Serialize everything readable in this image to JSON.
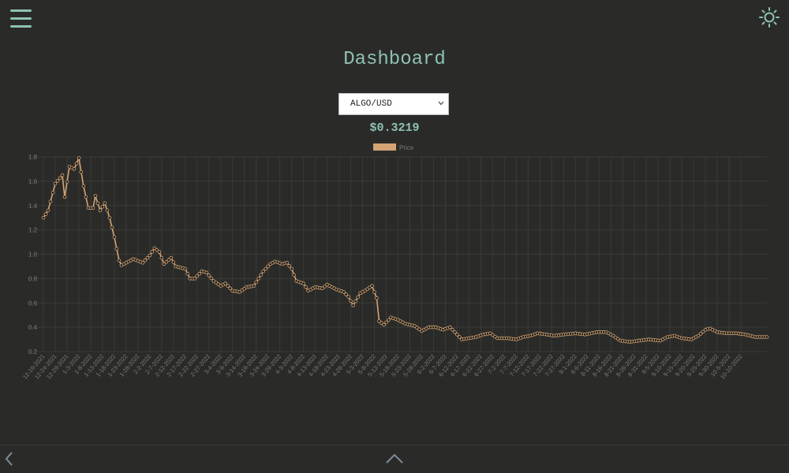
{
  "header": {
    "menu_icon": "hamburger-menu-icon",
    "theme_icon": "sun-icon",
    "title": "Dashboard"
  },
  "selector": {
    "selected": "ALGO/USD",
    "icon": "chevron-down-icon"
  },
  "current_price": "$0.3219",
  "footer": {
    "back_icon": "chevron-left-icon",
    "up_icon": "chevron-up-icon"
  },
  "colors": {
    "background": "#2a2b29",
    "accent": "#8fc1b2",
    "series": "#d4a373",
    "axis_text": "#7a7a7a",
    "grid": "#3a3b38"
  },
  "chart_data": {
    "type": "line",
    "legend": {
      "position": "top",
      "entries": [
        "Price"
      ]
    },
    "ylim": [
      0.2,
      1.8
    ],
    "y_ticks": [
      "0.2",
      "0.4",
      "0.6",
      "0.8",
      "1.0",
      "1.2",
      "1.4",
      "1.6",
      "1.8"
    ],
    "grid": true,
    "x_ticks": [
      "12-19-2021",
      "12-24-2021",
      "12-29-2021",
      "1-3-2022",
      "1-8-2022",
      "1-13-2022",
      "1-18-2022",
      "1-23-2022",
      "1-28-2022",
      "2-2-2022",
      "2-7-2022",
      "2-12-2022",
      "2-17-2022",
      "2-22-2022",
      "2-27-2022",
      "3-4-2022",
      "3-9-2022",
      "3-14-2022",
      "3-19-2022",
      "3-24-2022",
      "3-29-2022",
      "4-3-2022",
      "4-8-2022",
      "4-13-2022",
      "4-18-2022",
      "4-23-2022",
      "4-28-2022",
      "5-3-2022",
      "5-8-2022",
      "5-13-2022",
      "5-18-2022",
      "5-23-2022",
      "5-28-2022",
      "6-2-2022",
      "6-7-2022",
      "6-12-2022",
      "6-17-2022",
      "6-22-2022",
      "6-27-2022",
      "7-2-2022",
      "7-7-2022",
      "7-12-2022",
      "7-17-2022",
      "7-22-2022",
      "7-27-2022",
      "8-1-2022",
      "8-6-2022",
      "8-11-2022",
      "8-16-2022",
      "8-21-2022",
      "8-26-2022",
      "8-31-2022",
      "9-5-2022",
      "9-10-2022",
      "9-15-2022",
      "9-20-2022",
      "9-25-2022",
      "9-30-2022",
      "10-5-2022",
      "10-10-2022"
    ],
    "series": [
      {
        "name": "Price",
        "step_days": 1,
        "start_date": "12-19-2021",
        "keyframes": [
          {
            "date": "12-19-2021",
            "value": 1.3
          },
          {
            "date": "12-21-2021",
            "value": 1.36
          },
          {
            "date": "12-24-2021",
            "value": 1.58
          },
          {
            "date": "12-27-2021",
            "value": 1.65
          },
          {
            "date": "12-28-2021",
            "value": 1.47
          },
          {
            "date": "12-30-2021",
            "value": 1.72
          },
          {
            "date": "1-1-2022",
            "value": 1.7
          },
          {
            "date": "1-3-2022",
            "value": 1.79
          },
          {
            "date": "1-5-2022",
            "value": 1.56
          },
          {
            "date": "1-7-2022",
            "value": 1.38
          },
          {
            "date": "1-9-2022",
            "value": 1.38
          },
          {
            "date": "1-10-2022",
            "value": 1.48
          },
          {
            "date": "1-12-2022",
            "value": 1.36
          },
          {
            "date": "1-14-2022",
            "value": 1.42
          },
          {
            "date": "1-16-2022",
            "value": 1.3
          },
          {
            "date": "1-18-2022",
            "value": 1.14
          },
          {
            "date": "1-20-2022",
            "value": 0.95
          },
          {
            "date": "1-21-2022",
            "value": 0.91
          },
          {
            "date": "1-26-2022",
            "value": 0.96
          },
          {
            "date": "1-30-2022",
            "value": 0.93
          },
          {
            "date": "2-2-2022",
            "value": 0.99
          },
          {
            "date": "2-4-2022",
            "value": 1.05
          },
          {
            "date": "2-6-2022",
            "value": 1.02
          },
          {
            "date": "2-8-2022",
            "value": 0.92
          },
          {
            "date": "2-11-2022",
            "value": 0.97
          },
          {
            "date": "2-13-2022",
            "value": 0.9
          },
          {
            "date": "2-17-2022",
            "value": 0.88
          },
          {
            "date": "2-19-2022",
            "value": 0.8
          },
          {
            "date": "2-21-2022",
            "value": 0.8
          },
          {
            "date": "2-24-2022",
            "value": 0.86
          },
          {
            "date": "2-26-2022",
            "value": 0.85
          },
          {
            "date": "3-1-2022",
            "value": 0.78
          },
          {
            "date": "3-4-2022",
            "value": 0.74
          },
          {
            "date": "3-6-2022",
            "value": 0.76
          },
          {
            "date": "3-9-2022",
            "value": 0.7
          },
          {
            "date": "3-12-2022",
            "value": 0.69
          },
          {
            "date": "3-15-2022",
            "value": 0.73
          },
          {
            "date": "3-18-2022",
            "value": 0.74
          },
          {
            "date": "3-22-2022",
            "value": 0.86
          },
          {
            "date": "3-25-2022",
            "value": 0.92
          },
          {
            "date": "3-27-2022",
            "value": 0.94
          },
          {
            "date": "3-30-2022",
            "value": 0.92
          },
          {
            "date": "4-1-2022",
            "value": 0.93
          },
          {
            "date": "4-3-2022",
            "value": 0.88
          },
          {
            "date": "4-5-2022",
            "value": 0.78
          },
          {
            "date": "4-8-2022",
            "value": 0.76
          },
          {
            "date": "4-10-2022",
            "value": 0.7
          },
          {
            "date": "4-13-2022",
            "value": 0.73
          },
          {
            "date": "4-16-2022",
            "value": 0.72
          },
          {
            "date": "4-18-2022",
            "value": 0.75
          },
          {
            "date": "4-22-2022",
            "value": 0.71
          },
          {
            "date": "4-25-2022",
            "value": 0.69
          },
          {
            "date": "4-27-2022",
            "value": 0.65
          },
          {
            "date": "4-29-2022",
            "value": 0.58
          },
          {
            "date": "5-2-2022",
            "value": 0.68
          },
          {
            "date": "5-4-2022",
            "value": 0.7
          },
          {
            "date": "5-7-2022",
            "value": 0.74
          },
          {
            "date": "5-9-2022",
            "value": 0.64
          },
          {
            "date": "5-10-2022",
            "value": 0.45
          },
          {
            "date": "5-12-2022",
            "value": 0.42
          },
          {
            "date": "5-15-2022",
            "value": 0.48
          },
          {
            "date": "5-18-2022",
            "value": 0.46
          },
          {
            "date": "5-21-2022",
            "value": 0.43
          },
          {
            "date": "5-25-2022",
            "value": 0.41
          },
          {
            "date": "5-28-2022",
            "value": 0.37
          },
          {
            "date": "5-31-2022",
            "value": 0.4
          },
          {
            "date": "6-3-2022",
            "value": 0.4
          },
          {
            "date": "6-6-2022",
            "value": 0.38
          },
          {
            "date": "6-9-2022",
            "value": 0.4
          },
          {
            "date": "6-12-2022",
            "value": 0.34
          },
          {
            "date": "6-14-2022",
            "value": 0.3
          },
          {
            "date": "6-17-2022",
            "value": 0.31
          },
          {
            "date": "6-20-2022",
            "value": 0.32
          },
          {
            "date": "6-23-2022",
            "value": 0.34
          },
          {
            "date": "6-26-2022",
            "value": 0.35
          },
          {
            "date": "6-29-2022",
            "value": 0.31
          },
          {
            "date": "7-3-2022",
            "value": 0.31
          },
          {
            "date": "7-7-2022",
            "value": 0.3
          },
          {
            "date": "7-10-2022",
            "value": 0.32
          },
          {
            "date": "7-13-2022",
            "value": 0.33
          },
          {
            "date": "7-16-2022",
            "value": 0.35
          },
          {
            "date": "7-20-2022",
            "value": 0.34
          },
          {
            "date": "7-23-2022",
            "value": 0.33
          },
          {
            "date": "7-27-2022",
            "value": 0.34
          },
          {
            "date": "8-1-2022",
            "value": 0.35
          },
          {
            "date": "8-5-2022",
            "value": 0.34
          },
          {
            "date": "8-10-2022",
            "value": 0.36
          },
          {
            "date": "8-14-2022",
            "value": 0.36
          },
          {
            "date": "8-17-2022",
            "value": 0.33
          },
          {
            "date": "8-20-2022",
            "value": 0.29
          },
          {
            "date": "8-24-2022",
            "value": 0.28
          },
          {
            "date": "8-28-2022",
            "value": 0.29
          },
          {
            "date": "9-1-2022",
            "value": 0.3
          },
          {
            "date": "9-6-2022",
            "value": 0.29
          },
          {
            "date": "9-9-2022",
            "value": 0.32
          },
          {
            "date": "9-12-2022",
            "value": 0.33
          },
          {
            "date": "9-15-2022",
            "value": 0.31
          },
          {
            "date": "9-19-2022",
            "value": 0.3
          },
          {
            "date": "9-22-2022",
            "value": 0.33
          },
          {
            "date": "9-25-2022",
            "value": 0.38
          },
          {
            "date": "9-27-2022",
            "value": 0.39
          },
          {
            "date": "9-30-2022",
            "value": 0.36
          },
          {
            "date": "10-4-2022",
            "value": 0.35
          },
          {
            "date": "10-8-2022",
            "value": 0.35
          },
          {
            "date": "10-12-2022",
            "value": 0.34
          },
          {
            "date": "10-16-2022",
            "value": 0.32
          },
          {
            "date": "10-21-2022",
            "value": 0.32
          }
        ]
      }
    ]
  }
}
